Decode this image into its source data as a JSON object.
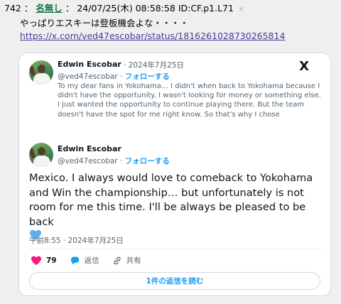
{
  "post": {
    "number": "742",
    "sep1": "：",
    "name": "名無し",
    "sep2": "：",
    "datetime": "24/07/25(木) 08:58:58",
    "id": "ID:CF.p1.L71",
    "close": "×",
    "text": "やっぱりエスキーは登板機会よな・・・・",
    "link": "https://x.com/ved47escobar/status/1816261028730265814"
  },
  "tweet": {
    "x_logo": "X",
    "quoted": {
      "author_name": "Edwin Escobar",
      "date": "· 2024年7月25日",
      "handle": "@ved47escobar",
      "dot": "·",
      "follow": "フォローする",
      "text": "To my dear fans in Yokohama… I didn't when back to Yokohama because I didn't have the opportunity. I wasn't looking for money or something else. I just wanted the opportunity to continue playing there. But the team doesn't have the spot for me right know. So that's why I chose"
    },
    "main": {
      "author_name": "Edwin Escobar",
      "handle": "@ved47escobar",
      "dot": "·",
      "follow": "フォローする",
      "text": "Mexico. I always would love to comeback to Yokohama and Win the championship… but unfortunately is not room for me this time. I'll be always be pleased to be back",
      "emoji": "blue-heart-icon"
    },
    "timestamp": "午前8:55 · 2024年7月25日",
    "actions": {
      "like_count": "79",
      "reply_label": "返信",
      "share_label": "共有"
    },
    "read_replies": "1件の返信を読む"
  },
  "colors": {
    "name_green": "#117743",
    "link_purple": "#4b3a9c",
    "twitter_blue": "#1d9bf0",
    "like_red": "#f91880",
    "heart_blue": "#5dadec"
  }
}
